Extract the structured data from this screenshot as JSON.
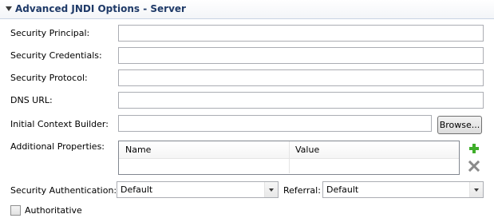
{
  "section": {
    "title": "Advanced JNDI Options - Server"
  },
  "fields": {
    "security_principal": {
      "label": "Security Principal:",
      "value": ""
    },
    "security_credentials": {
      "label": "Security Credentials:",
      "value": ""
    },
    "security_protocol": {
      "label": "Security Protocol:",
      "value": ""
    },
    "dns_url": {
      "label": "DNS URL:",
      "value": ""
    },
    "initial_context_builder": {
      "label": "Initial Context Builder:",
      "value": "",
      "browse_label": "Browse..."
    }
  },
  "additional_properties": {
    "label": "Additional Properties:",
    "columns": [
      "Name",
      "Value"
    ],
    "rows": [],
    "add_icon": "plus-icon",
    "remove_icon": "x-icon"
  },
  "security_authentication": {
    "label": "Security Authentication:",
    "selected": "Default"
  },
  "referral": {
    "label": "Referral:",
    "selected": "Default"
  },
  "authoritative": {
    "label": "Authoritative",
    "checked": false
  },
  "colors": {
    "section_title": "#1f3a68",
    "add_icon": "#3fae2a",
    "remove_icon": "#8a8a8a"
  }
}
